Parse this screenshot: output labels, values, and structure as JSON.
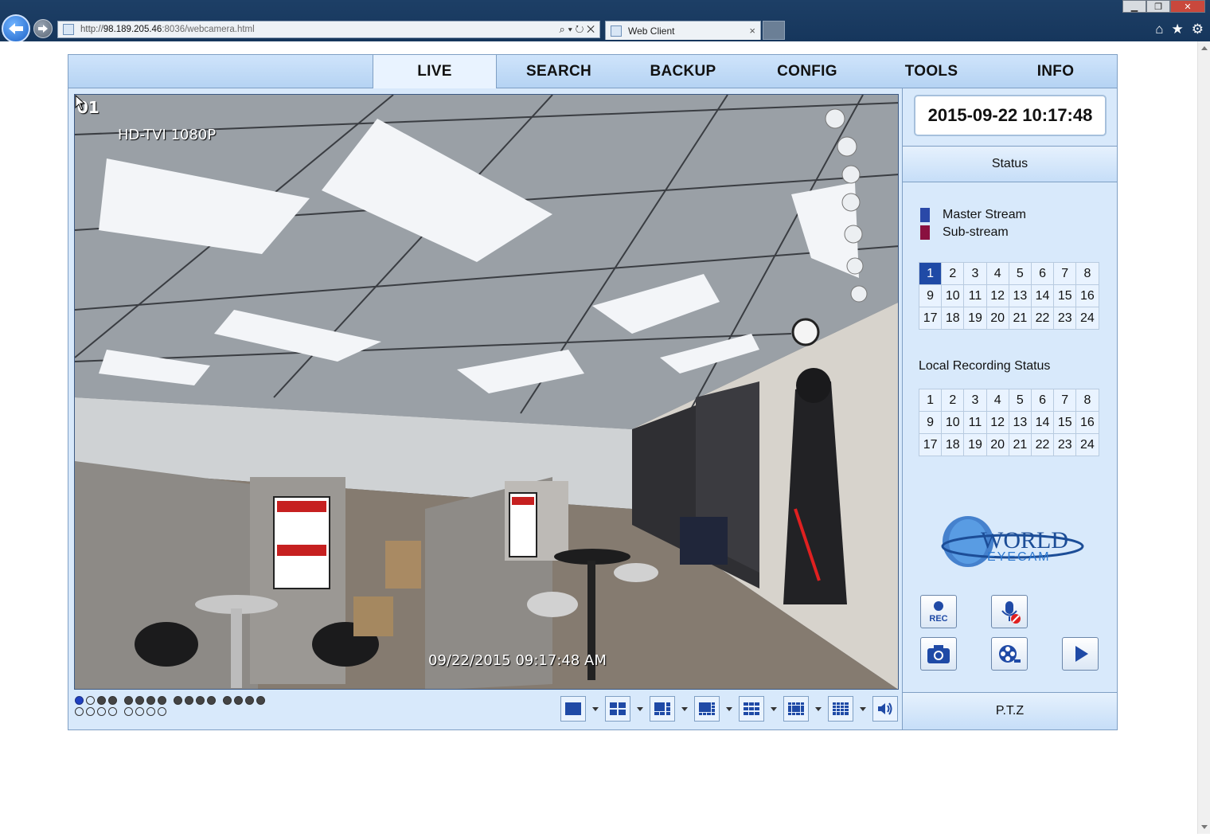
{
  "browser": {
    "url_scheme": "http://",
    "url_host": "98.189.205.46",
    "url_rest": ":8036/webcamera.html",
    "tab_title": "Web Client",
    "tab_close": "×",
    "address_tools": "⌕ ▾ ↻ ✕",
    "window_controls": [
      "▁",
      "❐",
      "✕"
    ],
    "tools": [
      "⌂",
      "★",
      "⚙"
    ]
  },
  "menu": {
    "tabs": [
      {
        "label": "LIVE",
        "active": true
      },
      {
        "label": "SEARCH"
      },
      {
        "label": "BACKUP"
      },
      {
        "label": "CONFIG"
      },
      {
        "label": "TOOLS"
      },
      {
        "label": "INFO"
      }
    ]
  },
  "video": {
    "channel": "01",
    "type": "HD-TVI 1080P",
    "timestamp": "09/22/2015 09:17:48 AM",
    "signs": {
      "warning": "WARNING",
      "aviso": "AVISO"
    }
  },
  "status_panel": {
    "datetime": "2015-09-22 10:17:48",
    "header": "Status",
    "legend": [
      {
        "label": "Master Stream",
        "color": "#2a49a8"
      },
      {
        "label": "Sub-stream",
        "color": "#8a1040"
      }
    ],
    "channels_row1": [
      "1",
      "2",
      "3",
      "4",
      "5",
      "6",
      "7",
      "8"
    ],
    "channels_row2": [
      "9",
      "10",
      "11",
      "12",
      "13",
      "14",
      "15",
      "16"
    ],
    "channels_row3": [
      "17",
      "18",
      "19",
      "20",
      "21",
      "22",
      "23",
      "24"
    ],
    "selected_channel": "1",
    "local_recording_label": "Local Recording Status",
    "logo_text_1": "WORLD",
    "logo_text_2": "EYECAM",
    "rec_label": "REC",
    "ptz_label": "P.T.Z"
  },
  "icons": [
    "back-icon",
    "forward-icon",
    "rec-icon",
    "mic-off-icon",
    "camera-icon",
    "film-reel-icon",
    "play-icon",
    "speaker-icon",
    "home-icon",
    "star-icon",
    "gear-icon"
  ]
}
